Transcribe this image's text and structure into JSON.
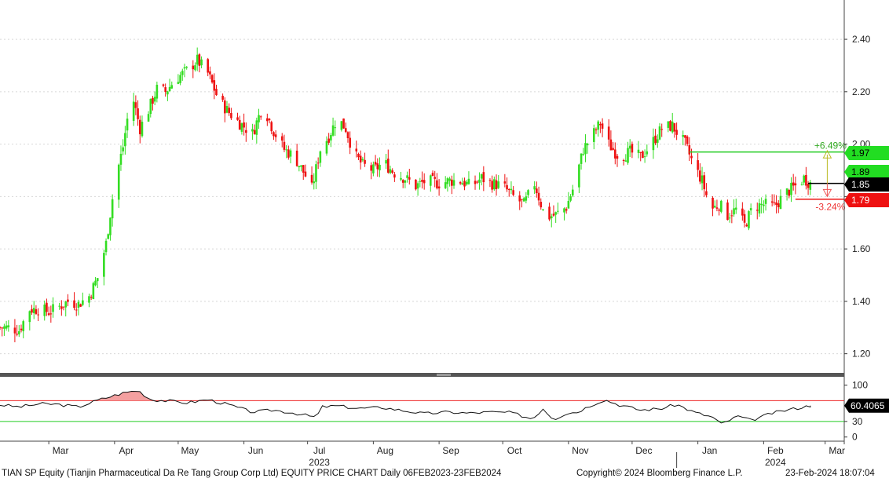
{
  "chart_data": {
    "type": "candlestick",
    "ylim": [
      1.13,
      2.55
    ],
    "yticks": [
      1.2,
      1.4,
      1.6,
      1.8,
      2.0,
      2.2,
      2.4
    ],
    "ytick_labels": [
      "1.20",
      "1.40",
      "1.60",
      "1.80",
      "2.00",
      "2.20",
      "2.40"
    ],
    "x_range": [
      "2023-02-06",
      "2024-03-10"
    ],
    "month_labels": [
      {
        "date": "2023-03-01",
        "label": "Mar"
      },
      {
        "date": "2023-04-01",
        "label": "Apr"
      },
      {
        "date": "2023-05-01",
        "label": "May"
      },
      {
        "date": "2023-06-01",
        "label": "Jun"
      },
      {
        "date": "2023-07-01",
        "label": "Jul"
      },
      {
        "date": "2023-08-01",
        "label": "Aug"
      },
      {
        "date": "2023-09-01",
        "label": "Sep"
      },
      {
        "date": "2023-10-01",
        "label": "Oct"
      },
      {
        "date": "2023-11-01",
        "label": "Nov"
      },
      {
        "date": "2023-12-01",
        "label": "Dec"
      },
      {
        "date": "2024-01-01",
        "label": "Jan"
      },
      {
        "date": "2024-02-01",
        "label": "Feb"
      },
      {
        "date": "2024-03-01",
        "label": "Mar"
      }
    ],
    "year_labels": [
      {
        "date": "2023-07-01",
        "label": "2023"
      },
      {
        "date": "2024-02-01",
        "label": "2024"
      }
    ],
    "up_color": "#33dd22",
    "down_color": "#ee1111",
    "close_path": [
      [
        "2023-02-06",
        1.3
      ],
      [
        "2023-02-10",
        1.3
      ],
      [
        "2023-02-15",
        1.29
      ],
      [
        "2023-02-20",
        1.37
      ],
      [
        "2023-02-25",
        1.37
      ],
      [
        "2023-03-01",
        1.36
      ],
      [
        "2023-03-06",
        1.38
      ],
      [
        "2023-03-10",
        1.4
      ],
      [
        "2023-03-15",
        1.39
      ],
      [
        "2023-03-20",
        1.42
      ],
      [
        "2023-03-24",
        1.49
      ],
      [
        "2023-03-28",
        1.62
      ],
      [
        "2023-04-01",
        1.85
      ],
      [
        "2023-04-05",
        1.99
      ],
      [
        "2023-04-09",
        2.2
      ],
      [
        "2023-04-13",
        2.06
      ],
      [
        "2023-04-17",
        2.13
      ],
      [
        "2023-04-21",
        2.21
      ],
      [
        "2023-04-25",
        2.2
      ],
      [
        "2023-04-30",
        2.25
      ],
      [
        "2023-05-05",
        2.28
      ],
      [
        "2023-05-10",
        2.32
      ],
      [
        "2023-05-15",
        2.27
      ],
      [
        "2023-05-20",
        2.17
      ],
      [
        "2023-05-25",
        2.12
      ],
      [
        "2023-05-30",
        2.08
      ],
      [
        "2023-06-05",
        2.04
      ],
      [
        "2023-06-10",
        2.15
      ],
      [
        "2023-06-15",
        2.05
      ],
      [
        "2023-06-20",
        1.98
      ],
      [
        "2023-06-25",
        1.95
      ],
      [
        "2023-06-30",
        1.88
      ],
      [
        "2023-07-03",
        1.83
      ],
      [
        "2023-07-07",
        1.98
      ],
      [
        "2023-07-11",
        2.03
      ],
      [
        "2023-07-15",
        2.1
      ],
      [
        "2023-07-19",
        2.06
      ],
      [
        "2023-07-23",
        1.96
      ],
      [
        "2023-07-27",
        1.92
      ],
      [
        "2023-08-01",
        1.9
      ],
      [
        "2023-08-06",
        1.93
      ],
      [
        "2023-08-11",
        1.89
      ],
      [
        "2023-08-16",
        1.87
      ],
      [
        "2023-08-21",
        1.84
      ],
      [
        "2023-08-26",
        1.86
      ],
      [
        "2023-09-01",
        1.85
      ],
      [
        "2023-09-06",
        1.86
      ],
      [
        "2023-09-11",
        1.86
      ],
      [
        "2023-09-16",
        1.84
      ],
      [
        "2023-09-21",
        1.87
      ],
      [
        "2023-09-26",
        1.85
      ],
      [
        "2023-10-01",
        1.84
      ],
      [
        "2023-10-06",
        1.8
      ],
      [
        "2023-10-11",
        1.77
      ],
      [
        "2023-10-16",
        1.85
      ],
      [
        "2023-10-21",
        1.72
      ],
      [
        "2023-10-26",
        1.73
      ],
      [
        "2023-10-31",
        1.76
      ],
      [
        "2023-11-04",
        1.85
      ],
      [
        "2023-11-08",
        1.98
      ],
      [
        "2023-11-12",
        2.03
      ],
      [
        "2023-11-16",
        2.08
      ],
      [
        "2023-11-20",
        2.0
      ],
      [
        "2023-11-25",
        1.95
      ],
      [
        "2023-11-30",
        1.97
      ],
      [
        "2023-12-05",
        1.95
      ],
      [
        "2023-12-10",
        2.0
      ],
      [
        "2023-12-15",
        2.06
      ],
      [
        "2023-12-20",
        2.07
      ],
      [
        "2023-12-26",
        2.0
      ],
      [
        "2023-12-30",
        1.92
      ],
      [
        "2024-01-03",
        1.86
      ],
      [
        "2024-01-07",
        1.75
      ],
      [
        "2024-01-11",
        1.77
      ],
      [
        "2024-01-15",
        1.73
      ],
      [
        "2024-01-19",
        1.75
      ],
      [
        "2024-01-23",
        1.69
      ],
      [
        "2024-01-27",
        1.76
      ],
      [
        "2024-02-01",
        1.77
      ],
      [
        "2024-02-06",
        1.76
      ],
      [
        "2024-02-11",
        1.81
      ],
      [
        "2024-02-16",
        1.84
      ],
      [
        "2024-02-20",
        1.87
      ],
      [
        "2024-02-23",
        1.85
      ]
    ],
    "price_tags": [
      {
        "label": "1.97",
        "bg": "#22dd22",
        "fg": "#000000",
        "y": 1.97
      },
      {
        "label": "1.89",
        "bg": "#22dd22",
        "fg": "#000000",
        "y": 1.89
      },
      {
        "label": "1.85",
        "bg": "#000000",
        "fg": "#ffffff",
        "y": 1.85
      },
      {
        "label": "1.79",
        "bg": "#ee1111",
        "fg": "#ffffff",
        "y": 1.79
      }
    ],
    "pct_up_label": "+6.49%",
    "pct_down_label": "-3.24%",
    "rsi": {
      "ylim": [
        -5,
        110
      ],
      "yticks": [
        0,
        30,
        100
      ],
      "ytick_labels": [
        "0",
        "30",
        "100"
      ],
      "overbought": 70,
      "oversold": 30,
      "last_value": 60.4065,
      "last_label": "60.4065",
      "path": [
        [
          "2023-02-06",
          62
        ],
        [
          "2023-02-15",
          58
        ],
        [
          "2023-02-25",
          64
        ],
        [
          "2023-03-05",
          63
        ],
        [
          "2023-03-15",
          58
        ],
        [
          "2023-03-25",
          72
        ],
        [
          "2023-04-05",
          85
        ],
        [
          "2023-04-12",
          90
        ],
        [
          "2023-04-18",
          72
        ],
        [
          "2023-04-25",
          70
        ],
        [
          "2023-05-05",
          66
        ],
        [
          "2023-05-15",
          72
        ],
        [
          "2023-05-25",
          62
        ],
        [
          "2023-06-05",
          48
        ],
        [
          "2023-06-15",
          52
        ],
        [
          "2023-06-25",
          46
        ],
        [
          "2023-07-05",
          38
        ],
        [
          "2023-07-08",
          58
        ],
        [
          "2023-07-15",
          60
        ],
        [
          "2023-07-25",
          55
        ],
        [
          "2023-08-05",
          57
        ],
        [
          "2023-08-15",
          51
        ],
        [
          "2023-08-25",
          45
        ],
        [
          "2023-09-05",
          48
        ],
        [
          "2023-09-15",
          46
        ],
        [
          "2023-09-25",
          48
        ],
        [
          "2023-10-05",
          47
        ],
        [
          "2023-10-15",
          35
        ],
        [
          "2023-10-20",
          55
        ],
        [
          "2023-10-25",
          34
        ],
        [
          "2023-10-31",
          46
        ],
        [
          "2023-11-05",
          48
        ],
        [
          "2023-11-12",
          62
        ],
        [
          "2023-11-18",
          72
        ],
        [
          "2023-11-25",
          62
        ],
        [
          "2023-12-05",
          52
        ],
        [
          "2023-12-15",
          55
        ],
        [
          "2023-12-22",
          63
        ],
        [
          "2023-12-30",
          48
        ],
        [
          "2024-01-08",
          38
        ],
        [
          "2024-01-12",
          25
        ],
        [
          "2024-01-20",
          40
        ],
        [
          "2024-01-26",
          32
        ],
        [
          "2024-02-05",
          46
        ],
        [
          "2024-02-12",
          52
        ],
        [
          "2024-02-23",
          60.4
        ]
      ]
    }
  },
  "footer": {
    "left": "TIAN SP Equity (Tianjin Pharmaceutical Da Re Tang Group Corp Ltd) EQUITY PRICE CHART  Daily 06FEB2023-23FEB2024",
    "middle": "Copyright© 2024 Bloomberg Finance L.P.",
    "right": "23-Feb-2024 18:07:04"
  }
}
